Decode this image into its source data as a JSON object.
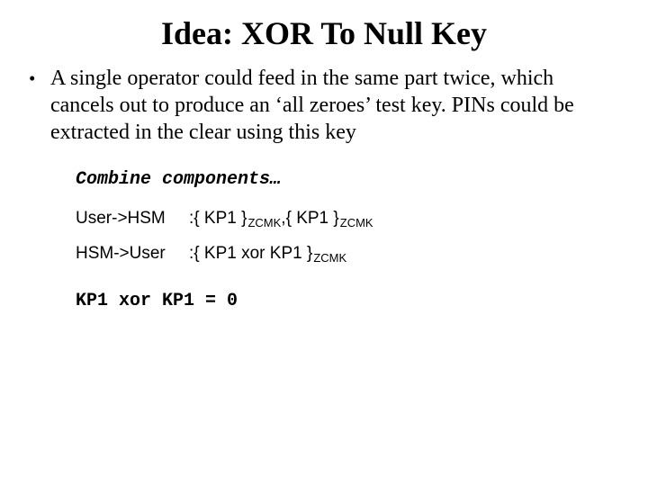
{
  "title": "Idea: XOR To Null Key",
  "bullet": {
    "mark": "•",
    "text": "A single operator could feed in the same part twice, which cancels out to produce an ‘all zeroes’ test key. PINs could be extracted in the clear using this key"
  },
  "combine_heading": "Combine components…",
  "protocol": {
    "row1": {
      "left": "User->HSM",
      "colon": ": ",
      "p1": "{ KP1 }",
      "sub1": "ZCMK",
      "comma": " , ",
      "p2": "{ KP1 }",
      "sub2": "ZCMK"
    },
    "row2": {
      "left": "HSM->User",
      "colon": ": ",
      "p1": "{ KP1 xor KP1 }",
      "sub1": "ZCMK"
    }
  },
  "identity": "KP1 xor KP1 = 0"
}
